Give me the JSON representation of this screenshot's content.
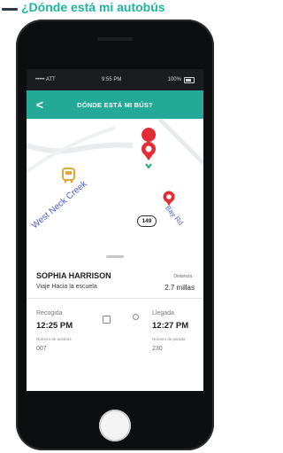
{
  "caption": {
    "text": "¿Dónde está mi autobús"
  },
  "status_bar": {
    "carrier": "••••• ATT",
    "time": "9:55 PM",
    "battery": "100%"
  },
  "header": {
    "back_label": "<",
    "title": "DÓNDE ESTÁ MI BÚS?"
  },
  "map": {
    "road_west": "West Neck Creek",
    "road_bay": "Bay Rd",
    "route_number": "149",
    "colors": {
      "bus": "#e3a43a",
      "stop": "#e32c35",
      "route": "#2b9bd7"
    }
  },
  "student": {
    "name": "SOPHIA HARRISON",
    "status": "Viaje Hacia la escuela",
    "distance_label": "Distancia",
    "distance_value": "2.7 millas"
  },
  "times": {
    "pickup_label": "Recogida",
    "pickup_time": "12:25 PM",
    "arrival_label": "Llegada",
    "arrival_time": "12:27 PM"
  },
  "bus_info": {
    "bus_number_label": "Número de autobús",
    "bus_number_value": "007",
    "stop_number_label": "Número de parada",
    "stop_number_value": "230"
  }
}
